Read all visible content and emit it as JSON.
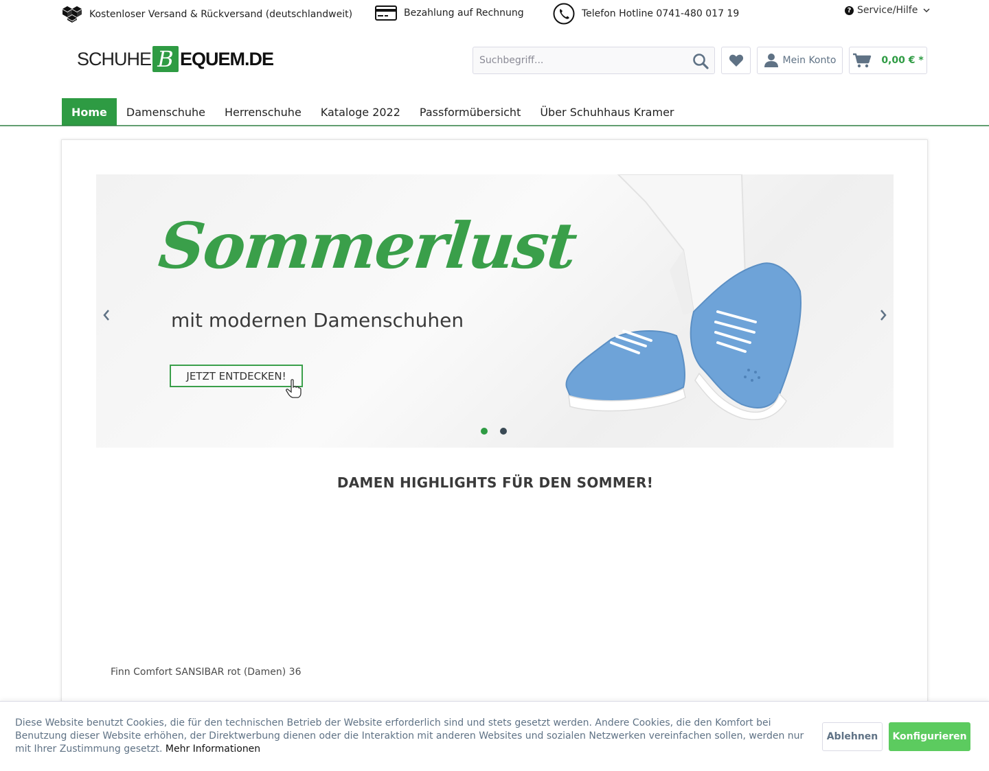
{
  "topbar": {
    "usp_shipping": "Kostenloser Versand & Rückversand (deutschlandweit)",
    "usp_payment": "Bezahlung auf Rechnung",
    "usp_hotline": "Telefon Hotline 0741-480 017 19",
    "service_label": "Service/Hilfe"
  },
  "header": {
    "logo_part1": "SCHUHE",
    "logo_letter": "B",
    "logo_part2": "EQUEM.DE",
    "search_placeholder": "Suchbegriff...",
    "account_label": "Mein Konto",
    "cart_total": "0,00 € *"
  },
  "nav": {
    "items": [
      "Home",
      "Damenschuhe",
      "Herrenschuhe",
      "Kataloge 2022",
      "Passformübersicht",
      "Über Schuhhaus Kramer"
    ]
  },
  "slider": {
    "headline": "Sommerlust",
    "subheadline": "mit modernen Damenschuhen",
    "cta": "JETZT ENTDECKEN!",
    "slide_count": 2,
    "active_slide": 1
  },
  "main": {
    "section_title": "DAMEN HIGHLIGHTS FÜR DEN SOMMER!",
    "product_name": "Finn Comfort SANSIBAR rot (Damen) 36"
  },
  "cookie": {
    "text": "Diese Website benutzt Cookies, die für den technischen Betrieb der Website erforderlich sind und stets gesetzt werden. Andere Cookies, die den Komfort bei Benutzung dieser Website erhöhen, der Direktwerbung dienen oder die Interaktion mit anderen Websites und sozialen Netzwerken vereinfachen sollen, werden nur mit Ihrer Zustimmung gesetzt.",
    "more_link": "Mehr Informationen",
    "decline_label": "Ablehnen",
    "configure_label": "Konfigurieren"
  },
  "colors": {
    "brand_green": "#2e9b43",
    "button_green": "#5ccb5f",
    "text_muted": "#5f7285"
  }
}
